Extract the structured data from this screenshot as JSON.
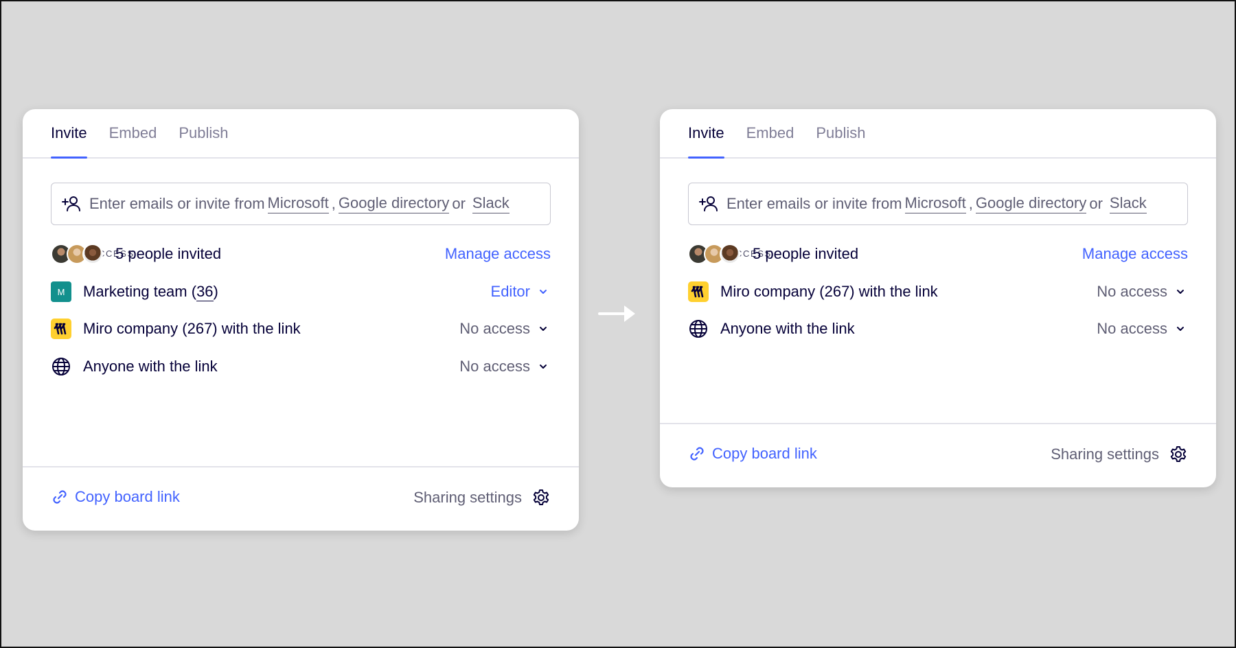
{
  "colors": {
    "accent": "#4262ff",
    "text": "#050038",
    "muted": "#5f5e74",
    "team": "#12908d",
    "miro_yellow": "#ffd02f"
  },
  "left_panel": {
    "tabs": [
      {
        "label": "Invite"
      },
      {
        "label": "Embed"
      },
      {
        "label": "Publish"
      }
    ],
    "search": {
      "prefix": "Enter emails or invite from",
      "microsoft": "Microsoft",
      "comma": ",",
      "google": "Google directory",
      "or": "or",
      "slack": "Slack"
    },
    "section_label": "BOARD ACCESS",
    "people": {
      "label": "5 people invited",
      "action": "Manage access"
    },
    "team": {
      "badge": "M",
      "name": "Marketing team (",
      "count": "36",
      "close": ")",
      "role": "Editor"
    },
    "company": {
      "label": "Miro company (267) with the link",
      "access": "No access"
    },
    "anyone": {
      "label": "Anyone with the link",
      "access": "No access"
    },
    "footer": {
      "copy": "Copy board link",
      "settings": "Sharing settings"
    }
  },
  "right_panel": {
    "tabs": [
      {
        "label": "Invite"
      },
      {
        "label": "Embed"
      },
      {
        "label": "Publish"
      }
    ],
    "search": {
      "prefix": "Enter emails or invite from",
      "microsoft": "Microsoft",
      "comma": ",",
      "google": "Google directory",
      "or": "or",
      "slack": "Slack"
    },
    "section_label": "BOARD ACCESS",
    "people": {
      "label": "5 people invited",
      "action": "Manage access"
    },
    "company": {
      "label": "Miro company (267) with the link",
      "access": "No access"
    },
    "anyone": {
      "label": "Anyone with the link",
      "access": "No access"
    },
    "footer": {
      "copy": "Copy board link",
      "settings": "Sharing settings"
    }
  },
  "icons": [
    "add-user-icon",
    "miro-logo-icon",
    "globe-icon",
    "chevron-down-icon",
    "link-icon",
    "gear-icon",
    "arrow-right-icon"
  ]
}
